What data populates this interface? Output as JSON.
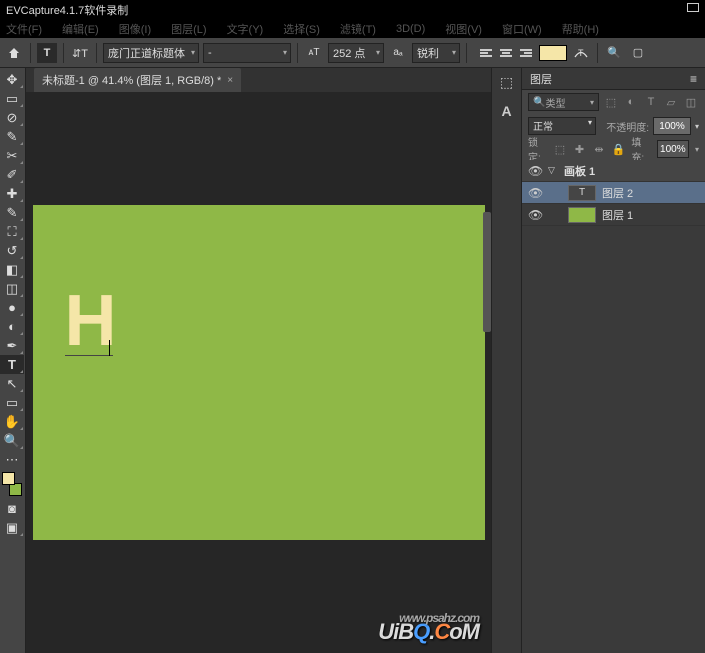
{
  "app_title": "EVCapture4.1.7软件录制",
  "menu": {
    "file": "文件(F)",
    "edit": "编辑(E)",
    "image": "图像(I)",
    "layer": "图层(L)",
    "type": "文字(Y)",
    "select": "选择(S)",
    "filter": "滤镜(T)",
    "view3d": "3D(D)",
    "view": "视图(V)",
    "window": "窗口(W)",
    "help": "帮助(H)"
  },
  "options": {
    "font_family": "庞门正道标题体",
    "font_style": "-",
    "font_size": "252 点",
    "aa": "锐利",
    "size_unit": "点"
  },
  "tab": {
    "label": "未标题-1 @ 41.4% (图层 1, RGB/8) *"
  },
  "canvas": {
    "letter": "H"
  },
  "panels": {
    "layers_title": "图层",
    "search_label": "类型",
    "blend_mode": "正常",
    "opacity_label": "不透明度:",
    "opacity_value": "100%",
    "lock_label": "锁定:",
    "fill_label": "填充:",
    "fill_value": "100%",
    "artboard": "画板 1",
    "layer2": "图层 2",
    "layer1": "图层 1"
  },
  "watermark": "UiBQ.CoM"
}
